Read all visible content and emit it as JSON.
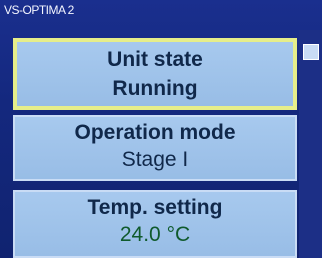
{
  "header": {
    "title": "VS-OPTIMA 2"
  },
  "tiles": [
    {
      "label": "Unit state",
      "value": "Running"
    },
    {
      "label": "Operation mode",
      "value": "Stage I"
    },
    {
      "label": "Temp. setting",
      "value": "24.0 °C"
    }
  ],
  "colors": {
    "background": "#1a2f8e",
    "tile": "#a7c9ee",
    "selected_border": "#e6ee8a"
  }
}
